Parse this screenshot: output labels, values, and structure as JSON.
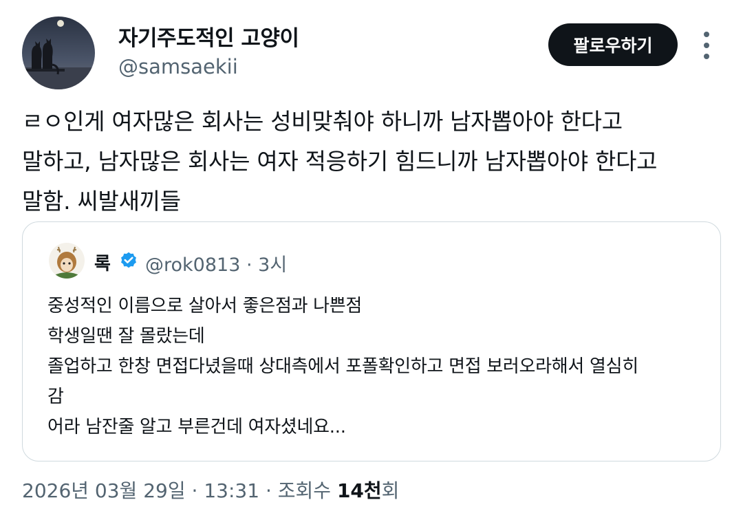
{
  "author": {
    "display_name": "자기주도적인 고양이",
    "handle": "@samsaekii",
    "avatar": "cat-silhouette-moon-avatar"
  },
  "follow_button": {
    "label": "팔로우하기"
  },
  "more_icon": "more-vertical-icon",
  "tweet": {
    "lines": [
      "ㄹㅇ인게 여자많은 회사는 성비맞춰야 하니까 남자뽑아야 한다고",
      "말하고, 남자많은 회사는 여자 적응하기 힘드니까 남자뽑아야 한다고",
      "말함. 씨발새끼들"
    ]
  },
  "quote": {
    "author_name": "록",
    "handle": "@rok0813",
    "separator": "·",
    "time": "3시",
    "verified": true,
    "lines": [
      "중성적인 이름으로 살아서 좋은점과 나쁜점",
      "학생일땐 잘 몰랐는데",
      "졸업하고 한창 면접다녔을때 상대측에서 포폴확인하고 면접 보러오라해서 열심히",
      "감",
      "어라 남잔줄 알고 부른건데 여자셨네요..."
    ]
  },
  "meta": {
    "date": "2026년 03월 29일",
    "time": "13:31",
    "views_label": "조회수",
    "views_count": "14천",
    "views_suffix": "회",
    "separator": "·"
  },
  "colors": {
    "text": "#0f1419",
    "secondary": "#536471",
    "border": "#cfd9de",
    "verified": "#1d9bf0",
    "follow_bg": "#0f1419"
  }
}
